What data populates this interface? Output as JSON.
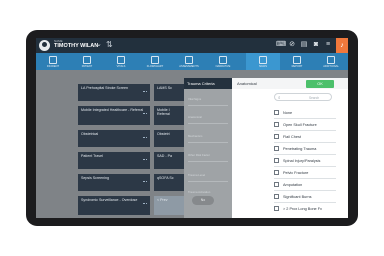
{
  "topbar": {
    "user_caption": "NAME",
    "user_name": "TIMOTHY WILAN",
    "icons": [
      "keyboard-icon",
      "block-icon",
      "calendar-icon",
      "camera-icon",
      "menu-icon",
      "bell-icon"
    ]
  },
  "nav": {
    "items": [
      {
        "label": "INCIDENT"
      },
      {
        "label": "PATIENT"
      },
      {
        "label": "VITALS"
      },
      {
        "label": "FLOWCHART"
      },
      {
        "label": "ASSESSMENTS"
      },
      {
        "label": "NARRATIVE"
      },
      {
        "label": "SIGNS"
      },
      {
        "label": "REPORT"
      },
      {
        "label": "ADDITIONAL"
      }
    ],
    "active_index": 6
  },
  "tiles": {
    "left": [
      "LA Prehospital Stroke Screen",
      "Mobile Integrated Healthcare - Referral",
      "Obstetrical",
      "Patient Travel",
      "Sepsis Screening",
      "Syndromic Surveillance - Overdose"
    ],
    "right": [
      "LAMS Sc",
      "Mobile I Referral",
      "Obstetri",
      "SAD - Pa",
      "qSOFA Sc",
      "< Prev"
    ]
  },
  "modal": {
    "title": "Trauma Criteria",
    "left_labels": [
      "Vital Signs",
      "Anatomical",
      "Mechanism",
      "Other Risk Factor",
      "Trauma Level",
      "Trauma Activation"
    ],
    "no_label": "No",
    "section": "Anatomical",
    "ok_label": "OK",
    "search_placeholder": "Search",
    "options": [
      "None",
      "Open Skull Fracture",
      "Flail Chest",
      "Penetrating Trauma",
      "Spinal Injury/Paralysis",
      "Pelvic Fracture",
      "Amputation",
      "Significant Burns",
      "> 2 Prox Long Bone Fx"
    ]
  }
}
